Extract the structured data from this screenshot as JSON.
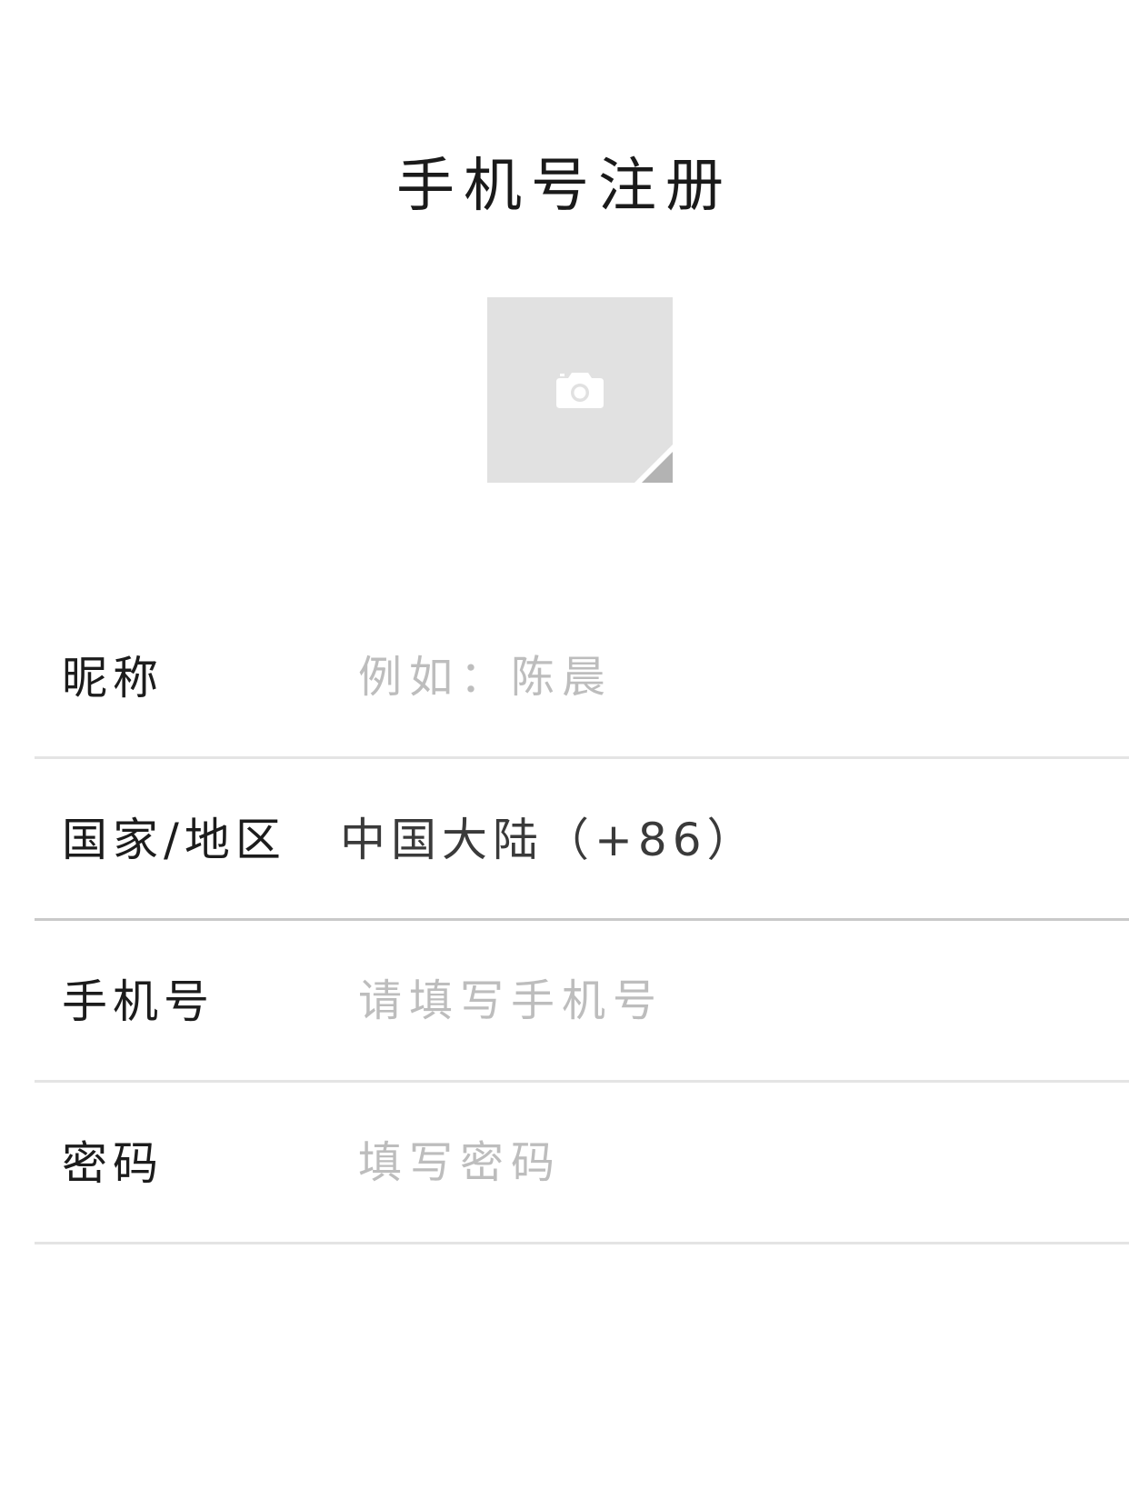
{
  "header": {
    "title": "手机号注册"
  },
  "avatar": {
    "icon": "camera-icon",
    "background_color": "#e1e1e1",
    "corner_color": "#b3b3b3"
  },
  "form": {
    "nickname": {
      "label": "昵称",
      "placeholder": "例如：陈晨",
      "value": ""
    },
    "region": {
      "label": "国家/地区",
      "value": "中国大陆（+86）"
    },
    "phone": {
      "label": "手机号",
      "placeholder": "请填写手机号",
      "value": ""
    },
    "password": {
      "label": "密码",
      "placeholder": "填写密码",
      "value": ""
    }
  }
}
